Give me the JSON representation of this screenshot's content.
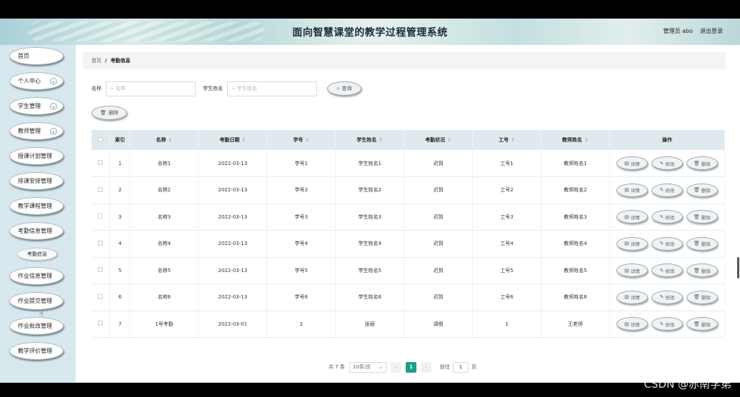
{
  "header": {
    "title": "面向智慧课堂的教学过程管理系统",
    "user": "管理员 abo",
    "logout": "退出登录"
  },
  "sidebar": {
    "items": [
      {
        "label": "首页",
        "expandable": false
      },
      {
        "label": "个人中心",
        "expandable": true
      },
      {
        "label": "学生管理",
        "expandable": true
      },
      {
        "label": "教师管理",
        "expandable": true
      },
      {
        "label": "授课计划管理",
        "expandable": false
      },
      {
        "label": "排课安排管理",
        "expandable": false
      },
      {
        "label": "教学课程管理",
        "expandable": false
      },
      {
        "label": "考勤信息管理",
        "expandable": false
      },
      {
        "label": "考勤信息",
        "sub": true
      },
      {
        "label": "作业信息管理",
        "expandable": false
      },
      {
        "label": "作业提交管理",
        "expandable": false
      },
      {
        "label": "作业批改管理",
        "expandable": false
      },
      {
        "label": "教学评价管理",
        "expandable": false
      }
    ]
  },
  "breadcrumb": {
    "home": "首页",
    "separator": "/",
    "current": "考勤信息"
  },
  "search": {
    "name_label": "名称",
    "name_placeholder": "名称",
    "student_label": "学生姓名",
    "student_placeholder": "学生姓名",
    "query_button": "查询"
  },
  "toolbar": {
    "delete_label": "删除"
  },
  "table": {
    "headers": [
      "索引",
      "名称",
      "考勤日期",
      "学号",
      "学生姓名",
      "考勤状况",
      "工号",
      "教师姓名",
      "操作"
    ],
    "rows": [
      {
        "index": "1",
        "name": "名称1",
        "date": "2022-03-13",
        "sno": "学号1",
        "student": "学生姓名1",
        "status": "迟到",
        "tno": "工号1",
        "teacher": "教师姓名1"
      },
      {
        "index": "2",
        "name": "名称2",
        "date": "2022-03-13",
        "sno": "学号2",
        "student": "学生姓名2",
        "status": "迟到",
        "tno": "工号2",
        "teacher": "教师姓名2"
      },
      {
        "index": "3",
        "name": "名称3",
        "date": "2022-03-13",
        "sno": "学号3",
        "student": "学生姓名3",
        "status": "迟到",
        "tno": "工号3",
        "teacher": "教师姓名3"
      },
      {
        "index": "4",
        "name": "名称4",
        "date": "2022-03-13",
        "sno": "学号4",
        "student": "学生姓名4",
        "status": "迟到",
        "tno": "工号4",
        "teacher": "教师姓名4"
      },
      {
        "index": "5",
        "name": "名称5",
        "date": "2022-03-13",
        "sno": "学号5",
        "student": "学生姓名5",
        "status": "迟到",
        "tno": "工号5",
        "teacher": "教师姓名5"
      },
      {
        "index": "6",
        "name": "名称6",
        "date": "2022-03-13",
        "sno": "学号6",
        "student": "学生姓名6",
        "status": "迟到",
        "tno": "工号6",
        "teacher": "教师姓名6"
      },
      {
        "index": "7",
        "name": "1号考勤",
        "date": "2022-03-01",
        "sno": "2",
        "student": "张丽",
        "status": "请假",
        "tno": "1",
        "teacher": "王老师"
      }
    ],
    "row_actions": {
      "detail": "详情",
      "edit": "修改",
      "delete": "删除"
    }
  },
  "pagination": {
    "total": "共 7 条",
    "page_size": "10条/页",
    "current_page": "1",
    "goto_label": "前往",
    "goto_value": "1",
    "page_unit": "页"
  },
  "watermark": "CSDN @赤南学弟",
  "colors": {
    "accent": "#1aa08a",
    "sidebar_bg": "#d7e9ef",
    "table_header_bg": "#dfeaef"
  }
}
